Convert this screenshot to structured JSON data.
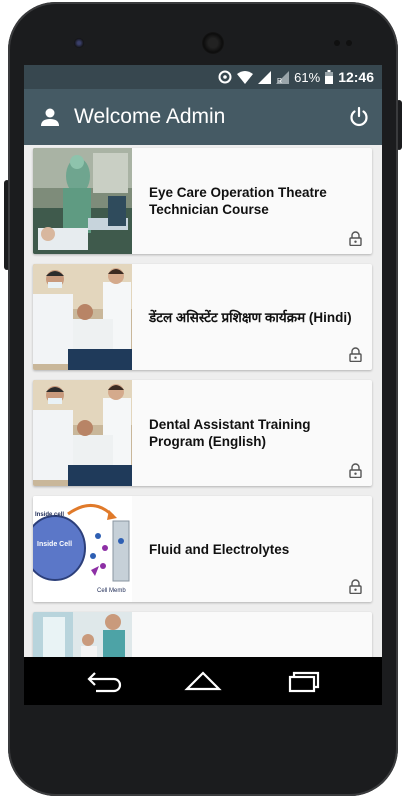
{
  "status_bar": {
    "battery_percent": "61%",
    "time": "12:46",
    "icons": [
      "data-saver-icon",
      "wifi-icon",
      "signal-icon",
      "signal-roaming-icon",
      "battery-icon"
    ]
  },
  "app_bar": {
    "title": "Welcome Admin",
    "user_icon": "person-icon",
    "logout_icon": "power-icon"
  },
  "courses": [
    {
      "title": "Eye Care Operation Theatre Technician Course",
      "locked": true,
      "image": "operation-theatre-photo"
    },
    {
      "title": " डेंटल असिस्टेंट प्रशिक्षण कार्यक्रम (Hindi)",
      "locked": true,
      "image": "dental-assistant-photo"
    },
    {
      "title": "Dental Assistant Training Program (English)",
      "locked": true,
      "image": "dental-assistant-photo"
    },
    {
      "title": "Fluid and Electrolytes",
      "locked": true,
      "image": "cell-diagram-image",
      "image_labels": [
        "Inside cell",
        "Inside Cell",
        "Cell Memb"
      ]
    },
    {
      "title": "",
      "locked": true,
      "image": "clinic-photo"
    }
  ],
  "nav_bar": {
    "buttons": [
      "back-icon",
      "home-icon",
      "recents-icon"
    ]
  },
  "colors": {
    "status_bar": "#37474f",
    "app_bar": "#455a64",
    "list_background": "#eeeeee",
    "card": "#fafafa"
  }
}
